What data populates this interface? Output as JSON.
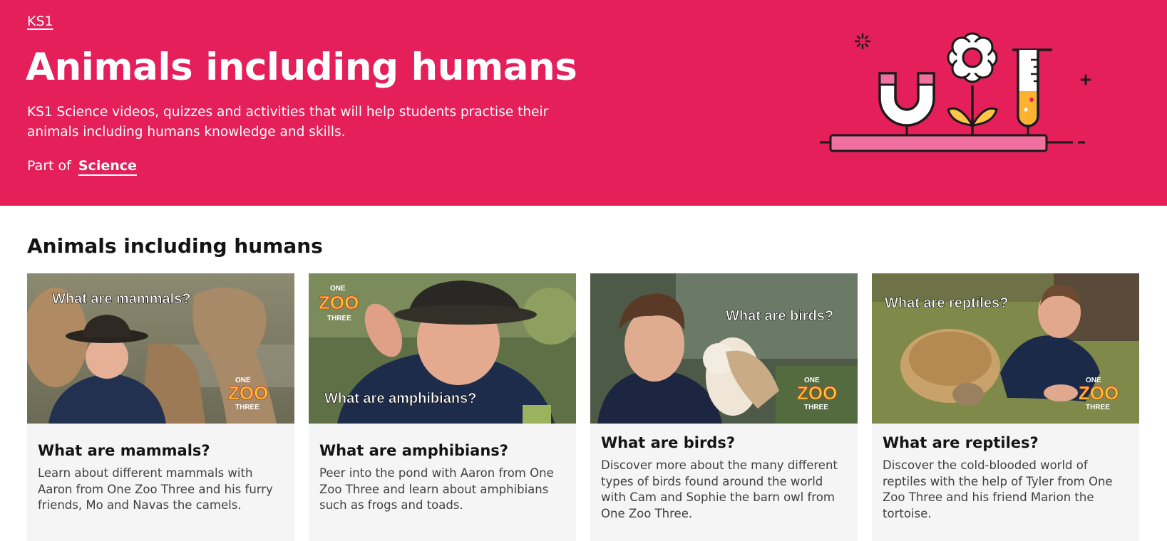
{
  "hero": {
    "level": "KS1",
    "title": "Animals including humans",
    "description": "KS1 Science videos, quizzes and activities that will help students practise their animals including humans knowledge and skills.",
    "part_of_label": "Part of",
    "part_of_link": "Science",
    "background_color": "#e41f5a"
  },
  "section": {
    "title": "Animals including humans"
  },
  "cards": [
    {
      "overlay": "What are mammals?",
      "logo_top": "ONE",
      "logo_mid": "ZOO",
      "logo_bot": "THREE",
      "title": "What are mammals?",
      "description": "Learn about different mammals with Aaron from One Zoo Three and his furry friends, Mo and Navas the camels."
    },
    {
      "overlay": "What are amphibians?",
      "logo_top": "ONE",
      "logo_mid": "ZOO",
      "logo_bot": "THREE",
      "title": "What are amphibians?",
      "description": "Peer into the pond with Aaron from One Zoo Three and learn about amphibians such as frogs and toads."
    },
    {
      "overlay": "What are birds?",
      "logo_top": "ONE",
      "logo_mid": "ZOO",
      "logo_bot": "THREE",
      "title": "What are birds?",
      "description": "Discover more about the many different types of birds found around the world with Cam and Sophie the barn owl from One Zoo Three."
    },
    {
      "overlay": "What are reptiles?",
      "logo_top": "ONE",
      "logo_mid": "ZOO",
      "logo_bot": "THREE",
      "title": "What are reptiles?",
      "description": "Discover the cold-blooded world of reptiles with the help of Tyler from One Zoo Three and his friend Marion the tortoise."
    }
  ]
}
